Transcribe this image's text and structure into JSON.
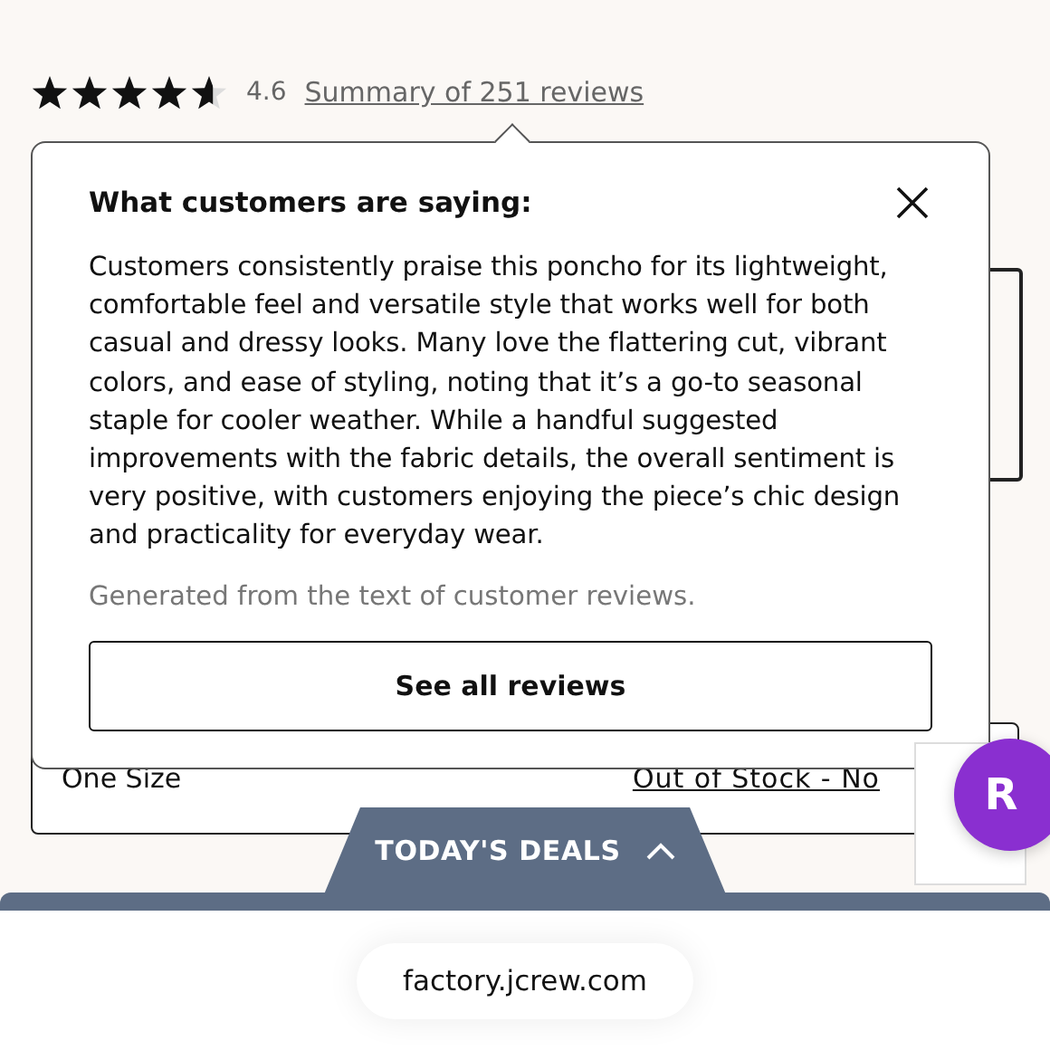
{
  "rating": {
    "stars": 4.6,
    "value": "4.6",
    "summary_link": "Summary of 251 reviews"
  },
  "size_option": {
    "label": "One Size",
    "status_link": "Out of Stock - No"
  },
  "popover": {
    "title": "What customers are saying:",
    "body": "Customers consistently praise this poncho for its lightweight, comfortable feel and versatile style that works well for both casual and dressy looks. Many love the flattering cut, vibrant colors, and ease of styling, noting that it’s a go-to seasonal staple for cooler weather. While a handful suggested improvements with the fabric details, the overall sentiment is very positive, with customers enjoying the piece’s chic design and practicality for everyday wear.",
    "note": "Generated from the text of customer reviews.",
    "button": "See all reviews"
  },
  "deals_tab": {
    "label": "TODAY'S DEALS",
    "expanded": false
  },
  "rewards_button": {
    "label": "R"
  },
  "address_bar": {
    "url": "factory.jcrew.com"
  }
}
